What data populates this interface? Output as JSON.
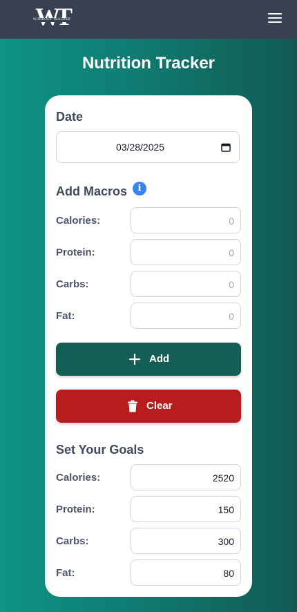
{
  "header": {
    "logo_letters": "WT",
    "logo_subtitle": "WORKOUT TRACKER",
    "menu_icon": "hamburger-menu-icon"
  },
  "page": {
    "title": "Nutrition Tracker"
  },
  "date_section": {
    "title": "Date",
    "value": "03/28/2025",
    "icon": "calendar-icon"
  },
  "macros": {
    "title": "Add Macros",
    "info_icon_glyph": "i",
    "fields": [
      {
        "label": "Calories:",
        "placeholder": "0"
      },
      {
        "label": "Protein:",
        "placeholder": "0"
      },
      {
        "label": "Carbs:",
        "placeholder": "0"
      },
      {
        "label": "Fat:",
        "placeholder": "0"
      }
    ]
  },
  "actions": {
    "add_label": "Add",
    "add_icon": "plus-icon",
    "clear_label": "Clear",
    "clear_icon": "trash-icon"
  },
  "goals": {
    "title": "Set Your Goals",
    "fields": [
      {
        "label": "Calories:",
        "value": "2520"
      },
      {
        "label": "Protein:",
        "value": "150"
      },
      {
        "label": "Carbs:",
        "value": "300"
      },
      {
        "label": "Fat:",
        "value": "80"
      }
    ]
  },
  "colors": {
    "navbar": "#374151",
    "background_start": "#0e9384",
    "background_end": "#115a53",
    "add_button": "#135e55",
    "clear_button": "#b91c1c",
    "info_icon": "#3b82f6"
  }
}
